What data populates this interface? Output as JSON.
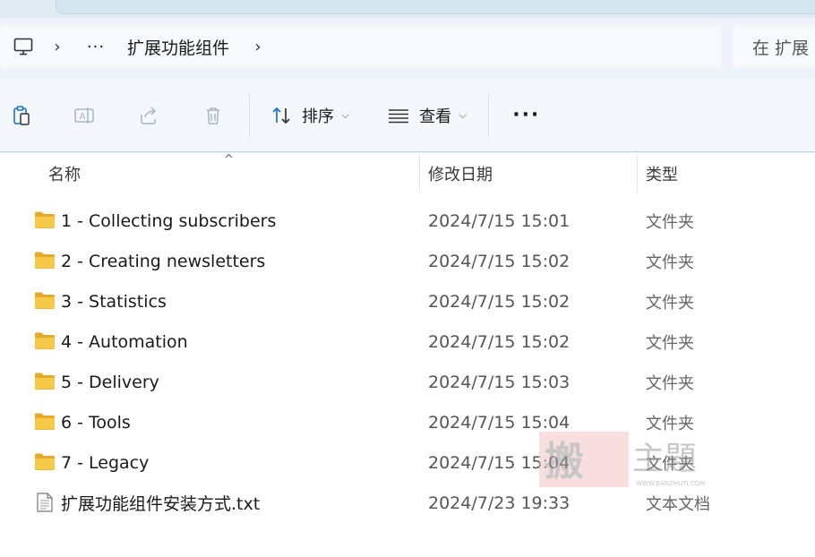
{
  "address_bar": {
    "breadcrumb_more": "···",
    "current_folder": "扩展功能组件",
    "search_placeholder": "在 扩展"
  },
  "toolbar": {
    "sort_label": "排序",
    "view_label": "查看",
    "more_label": "···"
  },
  "columns": {
    "name": "名称",
    "modified": "修改日期",
    "type": "类型"
  },
  "files": [
    {
      "name": "1 - Collecting subscribers",
      "modified": "2024/7/15 15:01",
      "type": "文件夹",
      "icon": "folder-icon"
    },
    {
      "name": "2 - Creating newsletters",
      "modified": "2024/7/15 15:02",
      "type": "文件夹",
      "icon": "folder-icon"
    },
    {
      "name": "3 - Statistics",
      "modified": "2024/7/15 15:02",
      "type": "文件夹",
      "icon": "folder-icon"
    },
    {
      "name": "4 - Automation",
      "modified": "2024/7/15 15:02",
      "type": "文件夹",
      "icon": "folder-icon"
    },
    {
      "name": "5 - Delivery",
      "modified": "2024/7/15 15:03",
      "type": "文件夹",
      "icon": "folder-icon"
    },
    {
      "name": "6 - Tools",
      "modified": "2024/7/15 15:04",
      "type": "文件夹",
      "icon": "folder-icon"
    },
    {
      "name": "7 - Legacy",
      "modified": "2024/7/15 15:04",
      "type": "文件夹",
      "icon": "folder-icon"
    },
    {
      "name": "扩展功能组件安装方式.txt",
      "modified": "2024/7/23 19:33",
      "type": "文本文档",
      "icon": "text-file-icon"
    }
  ],
  "watermark": {
    "text": "搬主题",
    "url": "WWW.BANZHUTI.COM"
  },
  "colors": {
    "folder": "#f2c34a",
    "accent": "#0067c0"
  }
}
